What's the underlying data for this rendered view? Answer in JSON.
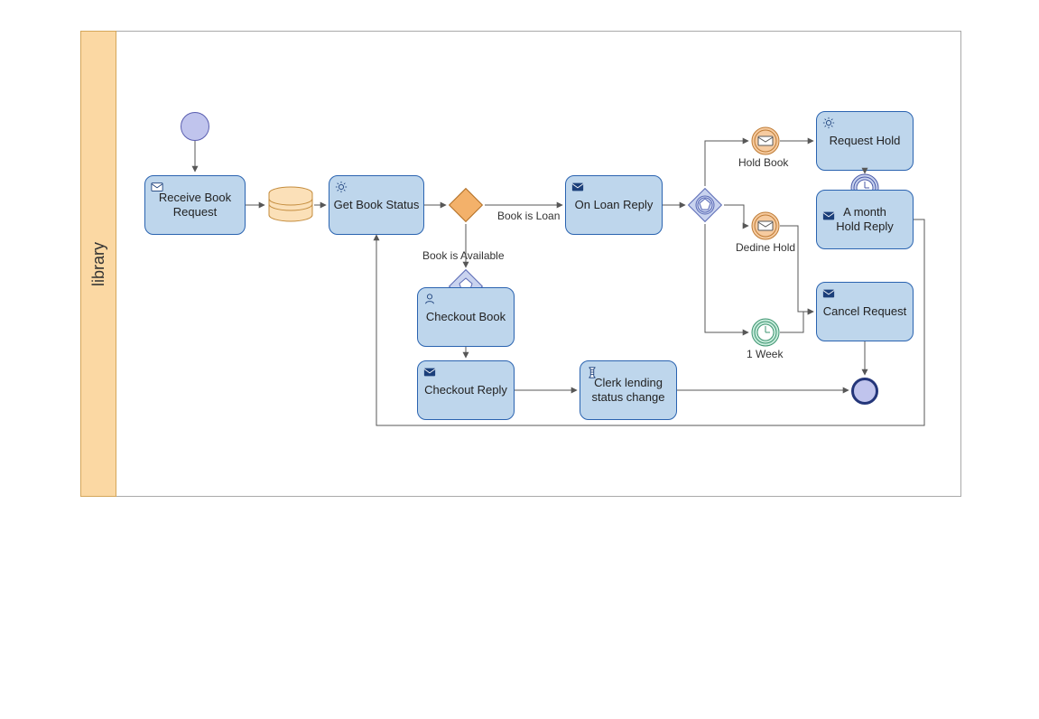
{
  "pool": {
    "label": "library"
  },
  "tasks": {
    "receive": {
      "label": "Receive Book Request"
    },
    "getstatus": {
      "label": "Get Book Status"
    },
    "onloan": {
      "label": "On Loan Reply"
    },
    "requesthold": {
      "label": "Request Hold"
    },
    "holdreply": {
      "label": "A month\nHold Reply"
    },
    "cancel": {
      "label": "Cancel Request"
    },
    "checkout": {
      "label": "Checkout Book"
    },
    "checkoutreply": {
      "label": "Checkout Reply"
    },
    "clerk": {
      "label": "Clerk lending status change"
    }
  },
  "edge_labels": {
    "book_is_loan": "Book is Loan",
    "book_is_available": "Book is Available",
    "hold_book": "Hold Book",
    "decline_hold": "Dedine Hold",
    "one_week": "1 Week"
  }
}
